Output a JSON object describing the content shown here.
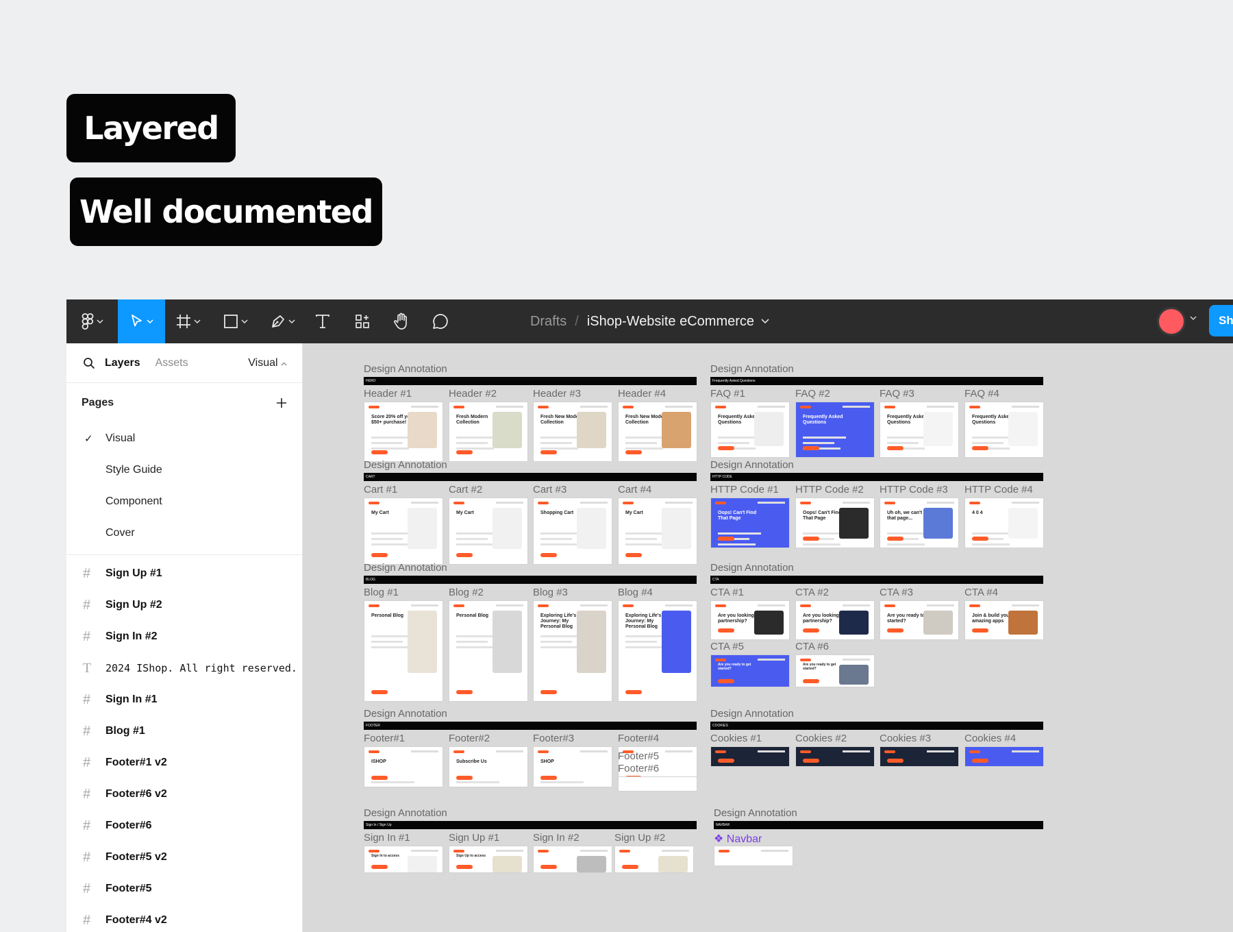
{
  "badges": {
    "layered": "Layered",
    "documented": "Well documented"
  },
  "toolbar": {
    "tools": [
      "figma-menu",
      "move",
      "frame",
      "shape",
      "pen",
      "text",
      "resources",
      "hand",
      "comment"
    ],
    "breadcrumb": {
      "drafts": "Drafts",
      "separator": "/",
      "file": "iShop-Website eCommerce"
    },
    "share_label": "Sh"
  },
  "sidebar": {
    "tabs": {
      "layers": "Layers",
      "assets": "Assets",
      "page": "Visual"
    },
    "pages_title": "Pages",
    "pages": [
      {
        "label": "Visual",
        "checked": true
      },
      {
        "label": "Style Guide",
        "checked": false
      },
      {
        "label": "Component",
        "checked": false
      },
      {
        "label": "Cover",
        "checked": false
      }
    ],
    "layers": [
      {
        "label": "Sign Up #1",
        "type": "frame"
      },
      {
        "label": "Sign Up #2",
        "type": "frame"
      },
      {
        "label": "Sign In #2",
        "type": "frame"
      },
      {
        "label": "2024 IShop. All right reserved.",
        "type": "text"
      },
      {
        "label": "Sign In #1",
        "type": "frame"
      },
      {
        "label": "Blog #1",
        "type": "frame"
      },
      {
        "label": "Footer#1 v2",
        "type": "frame"
      },
      {
        "label": "Footer#6 v2",
        "type": "frame"
      },
      {
        "label": "Footer#6",
        "type": "frame"
      },
      {
        "label": "Footer#5 v2",
        "type": "frame"
      },
      {
        "label": "Footer#5",
        "type": "frame"
      },
      {
        "label": "Footer#4 v2",
        "type": "frame"
      }
    ]
  },
  "canvas": {
    "sections": [
      {
        "id": "header",
        "annotation": "Design Annotation",
        "bar": "HERO",
        "cards": [
          {
            "label": "Header #1",
            "title": "Score 20% off your $50+ purchase!",
            "color": "#e8d9c8"
          },
          {
            "label": "Header #2",
            "title": "Fresh Modern Collection",
            "color": "#d8dcc8"
          },
          {
            "label": "Header #3",
            "title": "Fresh New Modern Collection",
            "color": "#e0d6c6"
          },
          {
            "label": "Header #4",
            "title": "Fresh New Modern Collection",
            "color": "#d9a36f"
          }
        ]
      },
      {
        "id": "faq",
        "annotation": "Design Annotation",
        "bar": "Frequently Asked Questions",
        "cards": [
          {
            "label": "FAQ #1",
            "title": "Frequently Asked Questions",
            "color": "#eeeeee"
          },
          {
            "label": "FAQ #2",
            "title": "Frequently Asked Questions",
            "color": "#4a5cf0"
          },
          {
            "label": "FAQ #3",
            "title": "Frequently Asked Questions",
            "color": "#f4f4f4"
          },
          {
            "label": "FAQ #4",
            "title": "Frequently Asked Questions",
            "color": "#f4f4f4"
          }
        ]
      },
      {
        "id": "cart",
        "annotation": "Design Annotation",
        "bar": "CART",
        "cards": [
          {
            "label": "Cart #1",
            "title": "My Cart",
            "color": "#f1f1f1"
          },
          {
            "label": "Cart #2",
            "title": "My Cart",
            "color": "#f1f1f1"
          },
          {
            "label": "Cart #3",
            "title": "Shopping Cart",
            "color": "#f1f1f1"
          },
          {
            "label": "Cart #4",
            "title": "My Cart",
            "color": "#f1f1f1"
          }
        ]
      },
      {
        "id": "http",
        "annotation": "Design Annotation",
        "bar": "HTTP CODE",
        "cards": [
          {
            "label": "HTTP Code #1",
            "title": "Oops! Can't Find That Page",
            "color": "#4a5cf0"
          },
          {
            "label": "HTTP Code #2",
            "title": "Oops! Can't Find That Page",
            "color": "#2b2b2b"
          },
          {
            "label": "HTTP Code #3",
            "title": "Uh oh, we can't find that page...",
            "color": "#5b7ad8"
          },
          {
            "label": "HTTP Code #4",
            "title": "4 0 4",
            "color": "#f4f4f4"
          }
        ]
      },
      {
        "id": "blog",
        "annotation": "Design Annotation",
        "bar": "BLOG",
        "cards": [
          {
            "label": "Blog #1",
            "title": "Personal Blog",
            "color": "#e9e2d6"
          },
          {
            "label": "Blog #2",
            "title": "Personal Blog",
            "color": "#d8d8d8"
          },
          {
            "label": "Blog #3",
            "title": "Exploring Life's Journey: My Personal Blog",
            "color": "#d9d3ca"
          },
          {
            "label": "Blog #4",
            "title": "Exploring Life's Journey: My Personal Blog",
            "color": "#4a5cf0"
          }
        ]
      },
      {
        "id": "cta",
        "annotation": "Design Annotation",
        "bar": "CTA",
        "cards": [
          {
            "label": "CTA #1",
            "title": "Are you looking for partnership?",
            "color": "#2b2b2b"
          },
          {
            "label": "CTA #2",
            "title": "Are you looking for partnership?",
            "color": "#1e2a4a"
          },
          {
            "label": "CTA #3",
            "title": "Are you ready to get started?",
            "color": "#cfcac2"
          },
          {
            "label": "CTA #4",
            "title": "Join & build your amazing apps",
            "color": "#c0733a"
          },
          {
            "label": "CTA #5",
            "title": "Are you ready to get started?",
            "color": "#4a5cf0"
          },
          {
            "label": "CTA #6",
            "title": "Are you ready to get started?",
            "color": "#6a7890"
          }
        ]
      },
      {
        "id": "footer",
        "annotation": "Design Annotation",
        "bar": "FOOTER",
        "cards": [
          {
            "label": "Footer#1",
            "title": "ISHOP",
            "color": "#ffffff"
          },
          {
            "label": "Footer#2",
            "title": "Subscribe Us",
            "color": "#ffffff"
          },
          {
            "label": "Footer#3",
            "title": "SHOP",
            "color": "#ffffff"
          },
          {
            "label": "Footer#4",
            "title": "",
            "color": "#ffffff"
          }
        ],
        "extra_labels": [
          "Footer#5",
          "Footer#6"
        ]
      },
      {
        "id": "cookies",
        "annotation": "Design Annotation",
        "bar": "COOKIES",
        "cards": [
          {
            "label": "Cookies #1",
            "title": "",
            "color": "#1c2438"
          },
          {
            "label": "Cookies #2",
            "title": "",
            "color": "#1c2438"
          },
          {
            "label": "Cookies #3",
            "title": "",
            "color": "#1c2438"
          },
          {
            "label": "Cookies #4",
            "title": "",
            "color": "#4a5cf0"
          }
        ]
      },
      {
        "id": "sign",
        "annotation": "Design Annotation",
        "bar": "Sign In / Sign Up",
        "cards": [
          {
            "label": "Sign In #1",
            "title": "Sign In to access",
            "color": "#f1f1f1"
          },
          {
            "label": "Sign Up #1",
            "title": "Sign Up to access",
            "color": "#e6e0cf"
          },
          {
            "label": "Sign In #2",
            "title": "",
            "color": "#bdbdbd"
          },
          {
            "label": "Sign Up #2",
            "title": "",
            "color": "#e6e0cf"
          }
        ]
      },
      {
        "id": "navbar",
        "annotation": "Design Annotation",
        "bar": "NAVBAR",
        "component_label": "Navbar",
        "cards": []
      }
    ]
  }
}
